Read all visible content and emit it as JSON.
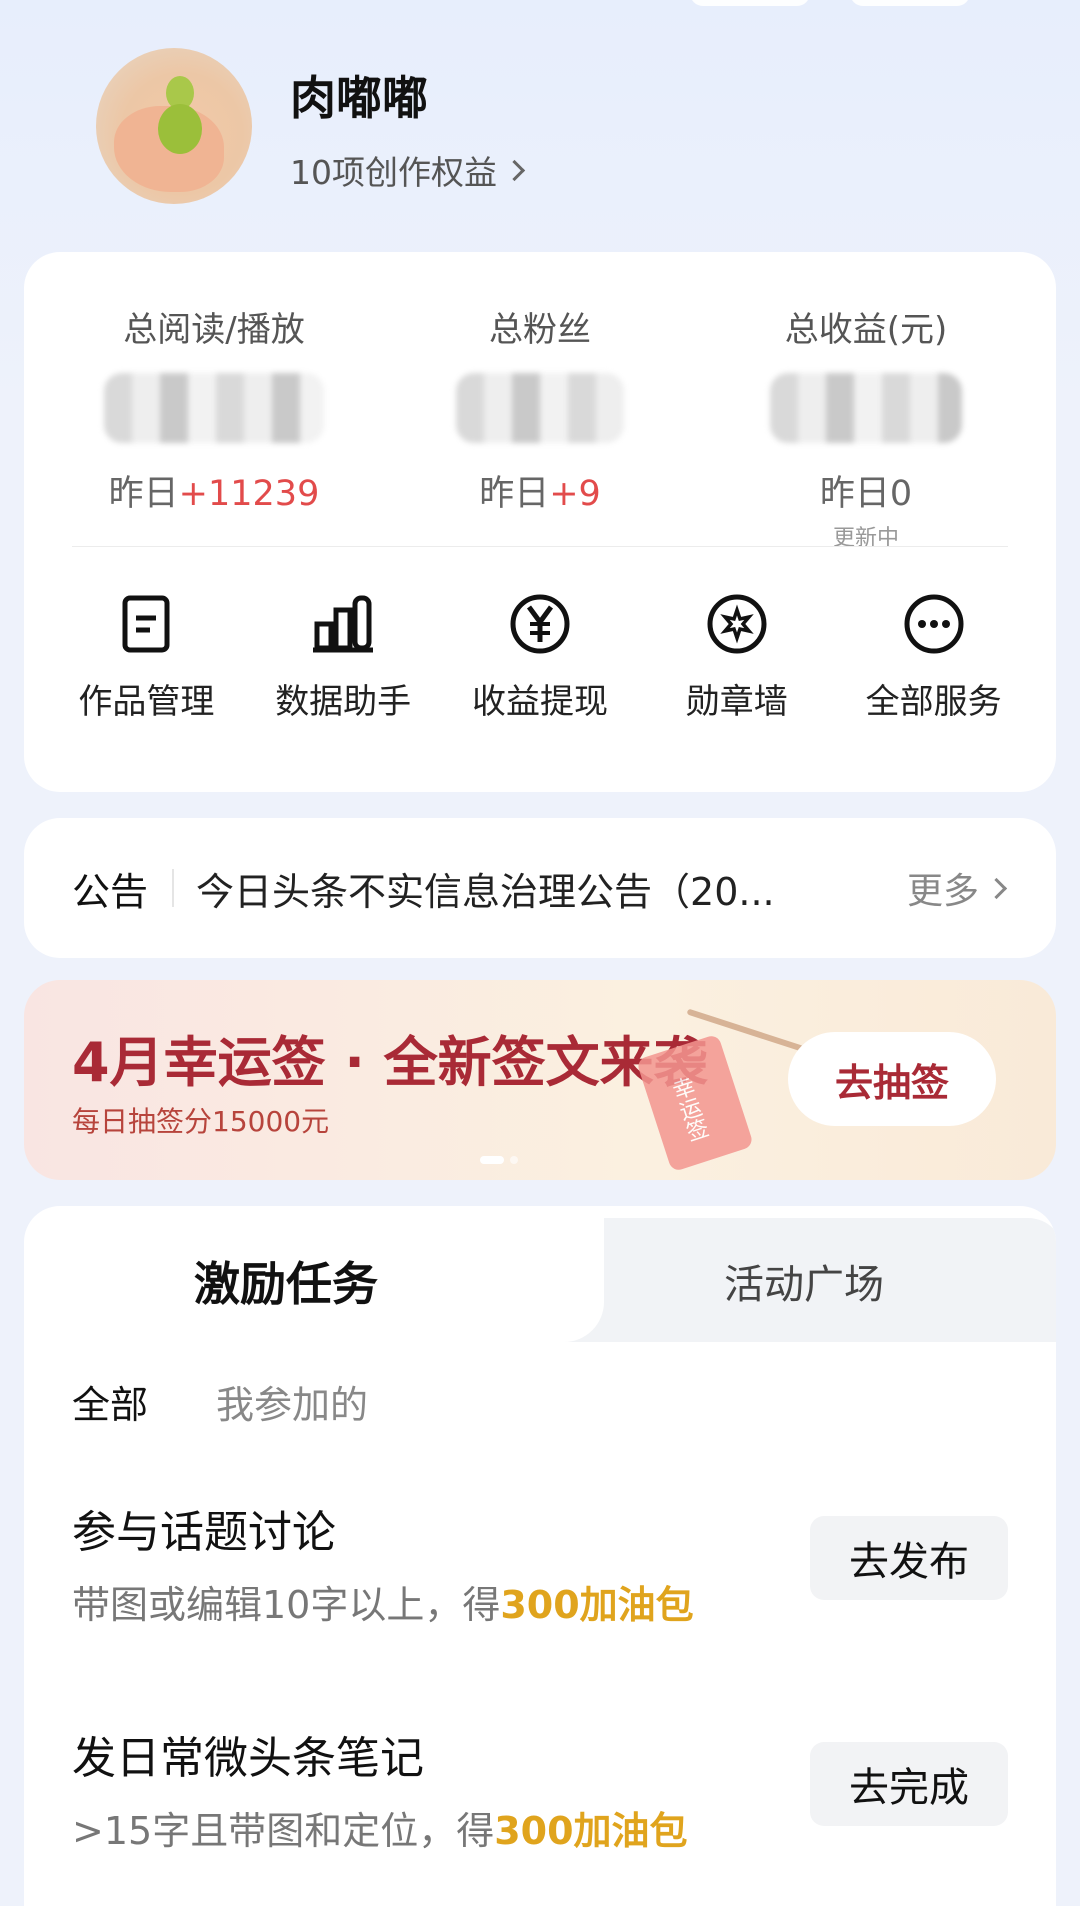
{
  "profile": {
    "username": "肉嘟嘟",
    "rights_link": "10项创作权益"
  },
  "stats": [
    {
      "label": "总阅读/播放",
      "delta_prefix": "昨日",
      "delta_value": "+11239",
      "sub": ""
    },
    {
      "label": "总粉丝",
      "delta_prefix": "昨日",
      "delta_value": "+9",
      "sub": ""
    },
    {
      "label": "总收益(元)",
      "delta_prefix": "昨日0",
      "delta_value": "",
      "sub": "更新中"
    }
  ],
  "tools": [
    {
      "label": "作品管理",
      "icon": "document-icon"
    },
    {
      "label": "数据助手",
      "icon": "bar-chart-icon"
    },
    {
      "label": "收益提现",
      "icon": "yen-icon"
    },
    {
      "label": "勋章墙",
      "icon": "medal-icon"
    },
    {
      "label": "全部服务",
      "icon": "more-icon"
    }
  ],
  "notice": {
    "tag": "公告",
    "text": "今日头条不实信息治理公告（20...",
    "more": "更多"
  },
  "banner": {
    "title": "4月幸运签 · 全新签文来袭",
    "subtitle": "每日抽签分15000元",
    "cta": "去抽签",
    "envelope_text": "幸运签"
  },
  "tasks": {
    "tabs": [
      "激励任务",
      "活动广场"
    ],
    "filters": [
      "全部",
      "我参加的"
    ],
    "items": [
      {
        "title": "参与话题讨论",
        "desc_prefix": "带图或编辑10字以上，得",
        "desc_reward": "300加油包",
        "button": "去发布"
      },
      {
        "title": "发日常微头条笔记",
        "desc_prefix": ">15字且带图和定位，得",
        "desc_reward": "300加油包",
        "button": "去完成"
      }
    ]
  },
  "colors": {
    "accent_red": "#e24b4b",
    "banner_red": "#a92a36",
    "reward_gold": "#e0a41d"
  }
}
